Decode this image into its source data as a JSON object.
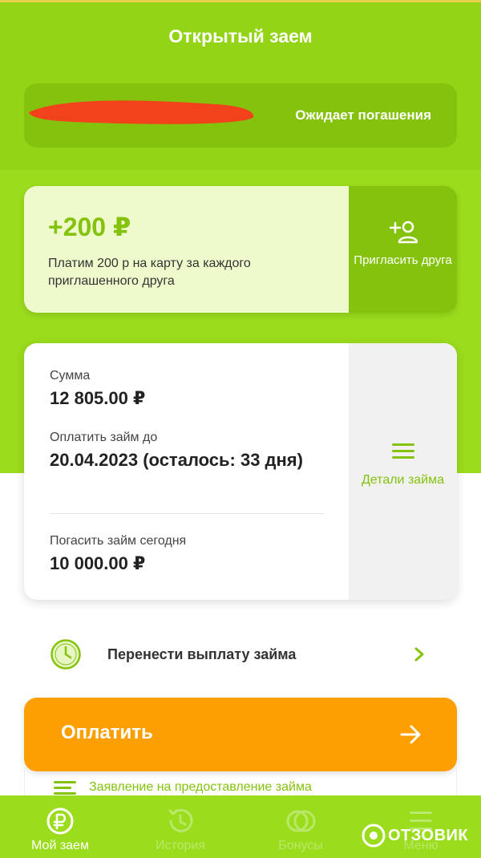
{
  "header": {
    "title": "Открытый заем"
  },
  "status": {
    "text": "Ожидает погашения",
    "redaction_color": "#f2421b"
  },
  "promo": {
    "amount": "+200 ₽",
    "description": "Платим 200 р на карту за каждого приглашенного друга",
    "invite_label": "Пригласить друга"
  },
  "loan": {
    "sum_label": "Сумма",
    "sum_value": "12 805.00 ₽",
    "due_label": "Оплатить займ до",
    "due_value": "20.04.2023 (осталось: 33 дня)",
    "today_label": "Погасить займ сегодня",
    "today_value": "10 000.00 ₽",
    "details_label": "Детали займа"
  },
  "transfer": {
    "label": "Перенести выплату займа"
  },
  "pay": {
    "label": "Оплатить"
  },
  "application": {
    "label": "Заявление на предоставление займа"
  },
  "nav": {
    "items": [
      {
        "label": "Мой заем",
        "icon": "ruble-coin-icon",
        "active": true
      },
      {
        "label": "История",
        "icon": "history-icon",
        "active": false
      },
      {
        "label": "Бонусы",
        "icon": "bonus-coins-icon",
        "active": false
      },
      {
        "label": "Меню",
        "icon": "menu-icon",
        "active": false
      }
    ]
  },
  "watermark": {
    "text": "ОТЗОВИК"
  },
  "colors": {
    "brand_green": "#9bdc1c",
    "dark_green": "#85c20d",
    "orange": "#fe9f00",
    "light_green": "#eefacc"
  }
}
